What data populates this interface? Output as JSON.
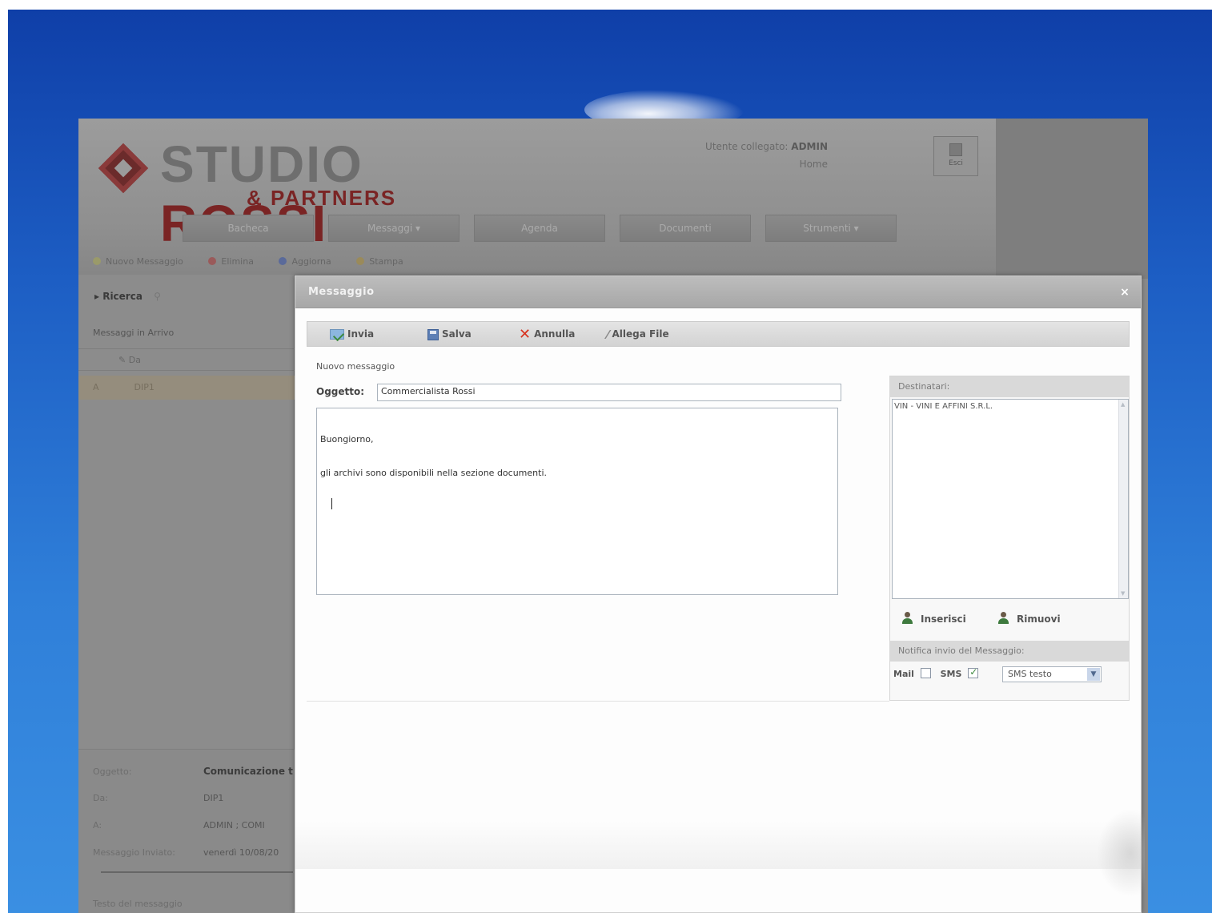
{
  "app": {
    "logo_line1": "STUDIO",
    "logo_line1b": "ROSSI",
    "logo_line2": "& PARTNERS",
    "user_label": "Utente collegato:",
    "user_name": "ADMIN",
    "home_link": "Home",
    "exit_label": "Esci",
    "nav": [
      "Bacheca",
      "Messaggi ▾",
      "Agenda",
      "Documenti",
      "Strumenti ▾"
    ],
    "subtoolbar": [
      "Nuovo Messaggio",
      "Elimina",
      "Aggiorna",
      "Stampa"
    ]
  },
  "left_panel": {
    "search_label": "Ricerca",
    "inbox_label": "Messaggi in Arrivo",
    "col_from": "Da",
    "row_flag": "A",
    "row_from": "DIP1",
    "detail": {
      "subject_key": "Oggetto:",
      "subject_val": "Comunicazione t",
      "from_key": "Da:",
      "from_val": "DIP1",
      "to_key": "A:",
      "to_val": "ADMIN ; COMI",
      "sent_key": "Messaggio Inviato:",
      "sent_val": "venerdì 10/08/20",
      "body_label": "Testo del messaggio"
    }
  },
  "modal": {
    "title": "Messaggio",
    "close": "×",
    "toolbar": {
      "send": "Invia",
      "save": "Salva",
      "cancel": "Annulla",
      "attach": "Allega File"
    },
    "new_message_label": "Nuovo messaggio",
    "subject_label": "Oggetto:",
    "subject_value": "Commercialista Rossi",
    "body_lines": [
      "Buongiorno,",
      "gli archivi sono disponibili nella sezione documenti."
    ],
    "recipients": {
      "header": "Destinatari:",
      "items": [
        "VIN - VINI E AFFINI S.R.L."
      ],
      "insert": "Inserisci",
      "remove": "Rimuovi"
    },
    "notify": {
      "header": "Notifica invio del Messaggio:",
      "mail_label": "Mail",
      "mail_checked": false,
      "sms_label": "SMS",
      "sms_checked": true,
      "sms_option": "SMS testo"
    }
  },
  "colors": {
    "desktop_top": "#0f3fa8",
    "desktop_bottom": "#3a8fe2",
    "brand_red": "#7a2424",
    "toolbar_cancel": "#d8321e"
  }
}
